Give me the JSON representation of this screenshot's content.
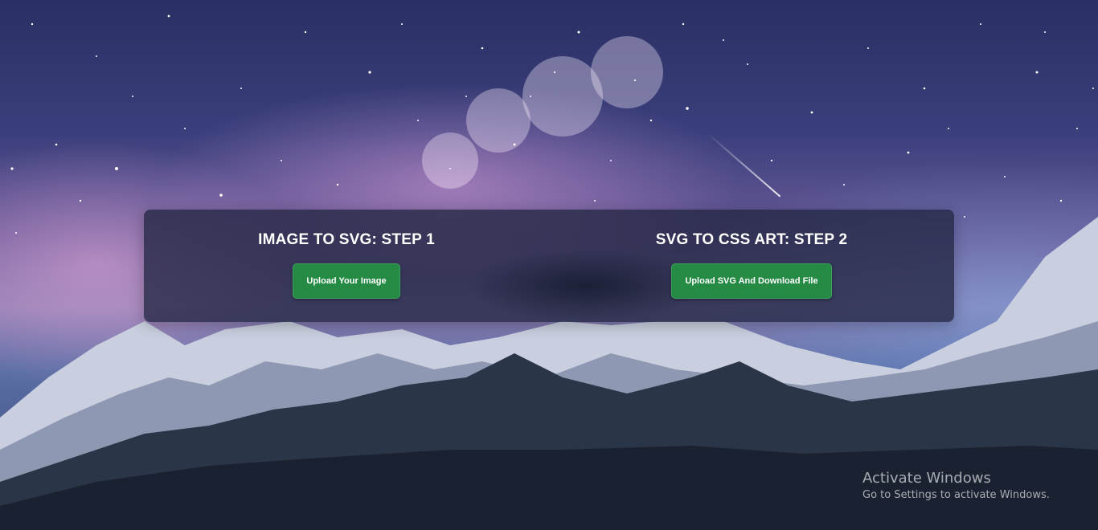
{
  "step1": {
    "title": "IMAGE TO SVG: STEP 1",
    "button_label": "Upload Your Image"
  },
  "step2": {
    "title": "SVG TO CSS ART: STEP 2",
    "button_label": "Upload SVG And Download File"
  },
  "watermark": {
    "title": "Activate Windows",
    "subtitle": "Go to Settings to activate Windows."
  },
  "colors": {
    "button": "#258a44",
    "panel": "#222642",
    "text": "#ffffff"
  }
}
